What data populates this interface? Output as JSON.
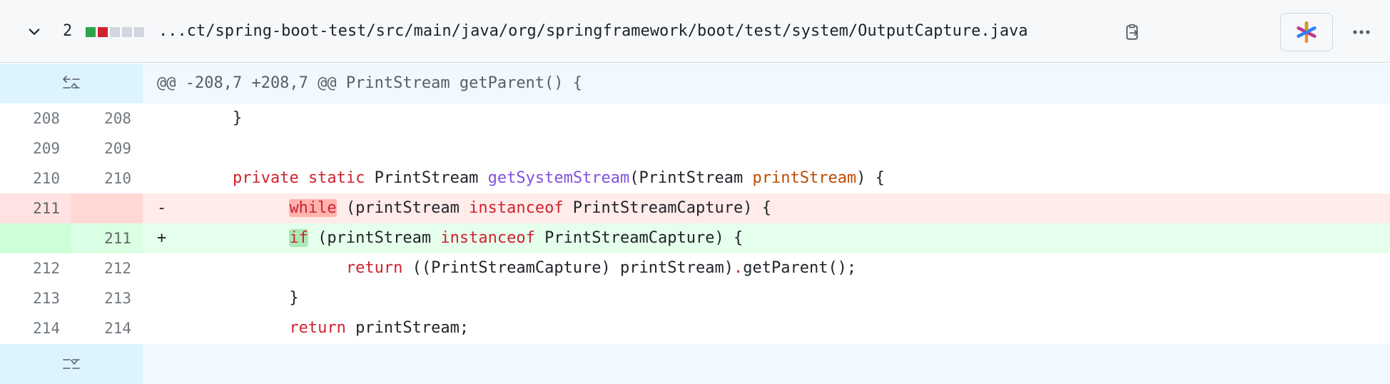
{
  "header": {
    "change_count": "2",
    "diffstat": [
      "#2da44e",
      "#cf222e",
      "#d0d7de",
      "#d0d7de",
      "#d0d7de"
    ],
    "file_path": "...ct/spring-boot-test/src/main/java/org/springframework/boot/test/system/OutputCapture.java",
    "icons": {
      "collapse": "chevron-down-icon",
      "copy": "copy-path-icon",
      "copilot": "copilot-icon",
      "more": "kebab-horizontal-icon"
    }
  },
  "hunk": {
    "header": "@@ -208,7 +208,7 @@ PrintStream getParent() {"
  },
  "lines": [
    {
      "old": "208",
      "new": "208",
      "type": "ctx",
      "text": "\t}"
    },
    {
      "old": "209",
      "new": "209",
      "type": "ctx",
      "text": ""
    },
    {
      "old": "210",
      "new": "210",
      "type": "ctx",
      "text": "\tprivate static PrintStream getSystemStream(PrintStream printStream) {"
    },
    {
      "old": "211",
      "new": "",
      "type": "del",
      "marker": "-",
      "text": "\t\twhile (printStream instanceof PrintStreamCapture) {"
    },
    {
      "old": "",
      "new": "211",
      "type": "add",
      "marker": "+",
      "text": "\t\tif (printStream instanceof PrintStreamCapture) {"
    },
    {
      "old": "212",
      "new": "212",
      "type": "ctx",
      "text": "\t\t\treturn ((PrintStreamCapture) printStream).getParent();"
    },
    {
      "old": "213",
      "new": "213",
      "type": "ctx",
      "text": "\t\t}"
    },
    {
      "old": "214",
      "new": "214",
      "type": "ctx",
      "text": "\t\treturn printStream;"
    }
  ],
  "colors": {
    "added_bg": "#e6ffec",
    "deleted_bg": "#ffebe9",
    "hunk_bg": "#f1f8ff",
    "keyword": "#cf222e",
    "function": "#8250df",
    "parameter": "#bc4c00"
  }
}
